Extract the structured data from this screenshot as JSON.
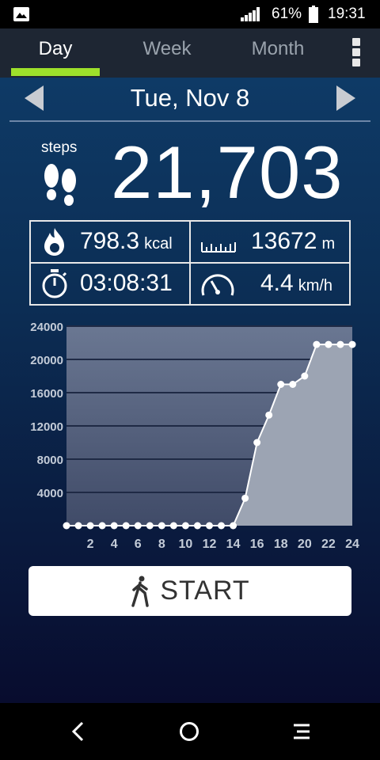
{
  "status_bar": {
    "battery_percent": "61%",
    "time": "19:31",
    "icons": [
      "image-icon",
      "signal-icon",
      "battery-icon"
    ]
  },
  "tabs": [
    {
      "label": "Day",
      "active": true
    },
    {
      "label": "Week",
      "active": false
    },
    {
      "label": "Month",
      "active": false
    }
  ],
  "date": "Tue, Nov 8",
  "steps": {
    "label": "steps",
    "count": "21,703"
  },
  "stats": {
    "calories": {
      "value": "798.3",
      "unit": "kcal"
    },
    "distance": {
      "value": "13672",
      "unit": "m"
    },
    "duration": {
      "value": "03:08:31"
    },
    "speed": {
      "value": "4.4",
      "unit": "km/h"
    }
  },
  "start_button": {
    "label": "START"
  },
  "colors": {
    "accent": "#9ee02b",
    "tab_bar": "#1e2633",
    "background_top": "#0e3a66",
    "background_bottom": "#080c2e"
  },
  "chart_data": {
    "type": "area",
    "x": [
      0,
      1,
      2,
      3,
      4,
      5,
      6,
      7,
      8,
      9,
      10,
      11,
      12,
      13,
      14,
      15,
      16,
      17,
      18,
      19,
      20,
      21,
      22,
      23,
      24
    ],
    "values": [
      0,
      0,
      0,
      0,
      0,
      0,
      0,
      0,
      0,
      0,
      0,
      0,
      0,
      0,
      0,
      3300,
      10000,
      13300,
      17000,
      17000,
      18000,
      21800,
      21800,
      21800,
      21800
    ],
    "x_tick_labels": [
      "2",
      "4",
      "6",
      "8",
      "10",
      "12",
      "14",
      "16",
      "18",
      "20",
      "22",
      "24"
    ],
    "y_tick_labels": [
      "4000",
      "8000",
      "12000",
      "16000",
      "20000",
      "24000"
    ],
    "xlim": [
      0,
      24
    ],
    "ylim": [
      0,
      24000
    ],
    "grid": true
  }
}
